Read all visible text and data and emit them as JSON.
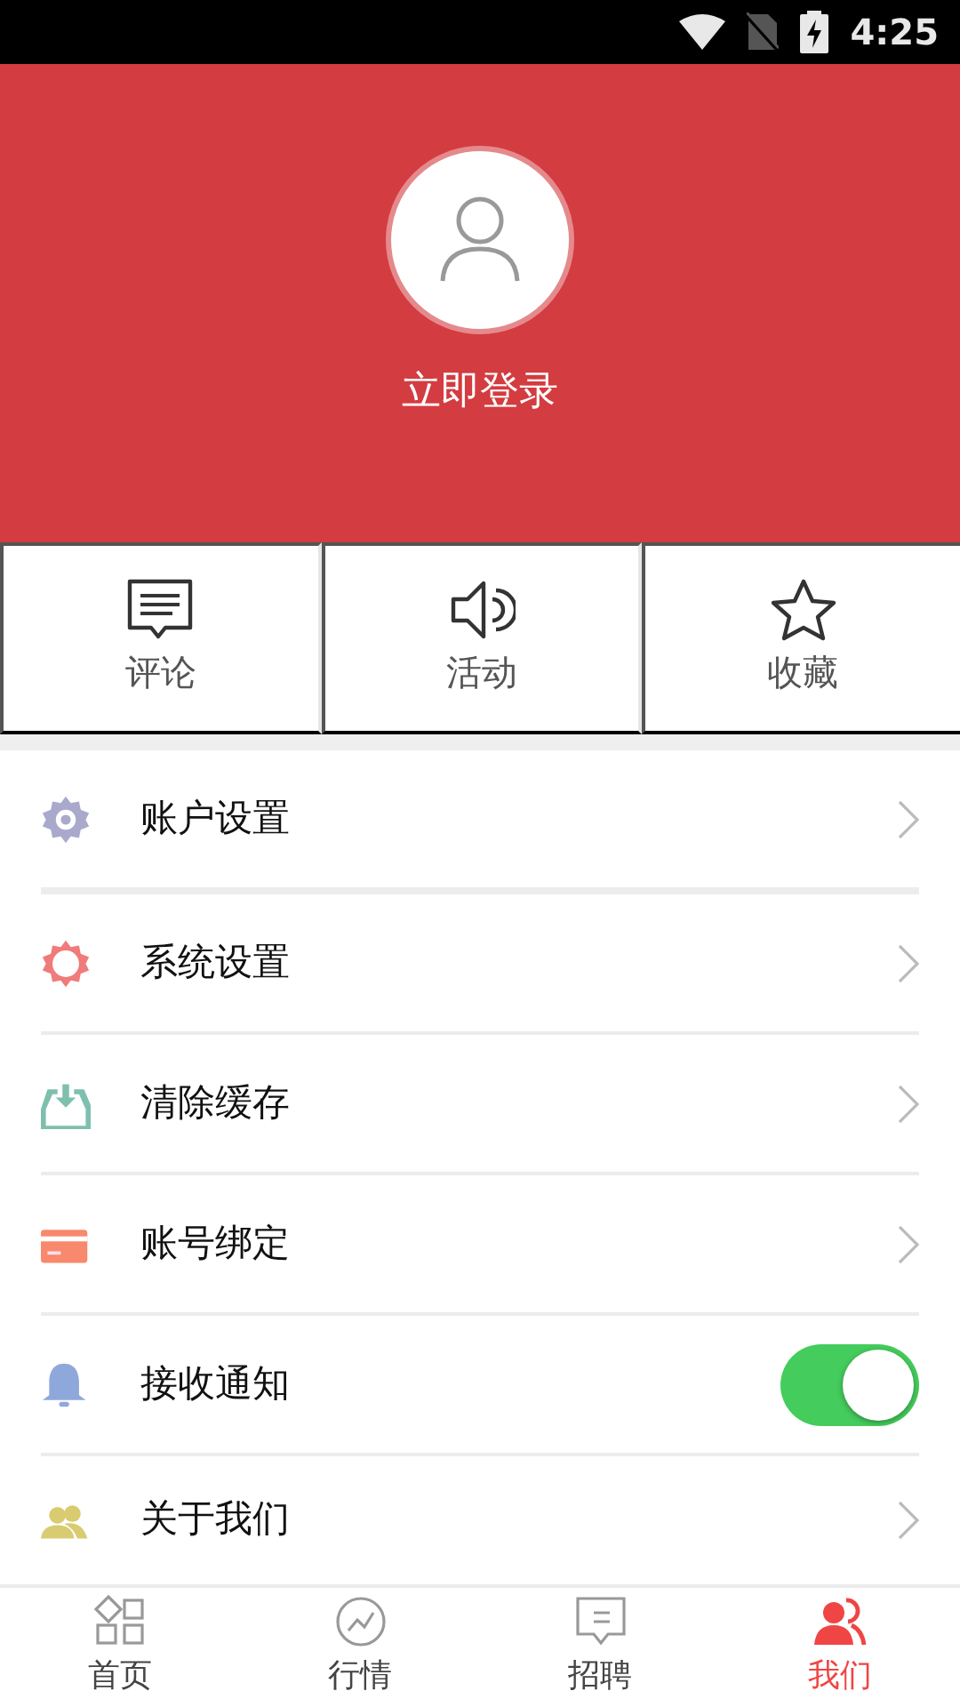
{
  "status_bar": {
    "time": "4:25"
  },
  "header": {
    "login": "立即登录"
  },
  "quick_actions": [
    {
      "label": "评论"
    },
    {
      "label": "活动"
    },
    {
      "label": "收藏"
    }
  ],
  "menu": [
    {
      "label": "账户设置",
      "kind": "link"
    },
    {
      "label": "系统设置",
      "kind": "link"
    },
    {
      "label": "清除缓存",
      "kind": "link"
    },
    {
      "label": "账号绑定",
      "kind": "link"
    },
    {
      "label": "接收通知",
      "kind": "toggle",
      "on": true
    },
    {
      "label": "关于我们",
      "kind": "link"
    }
  ],
  "tab_bar": [
    {
      "label": "首页",
      "selected": false
    },
    {
      "label": "行情",
      "selected": false
    },
    {
      "label": "招聘",
      "selected": false
    },
    {
      "label": "我们",
      "selected": true
    }
  ]
}
